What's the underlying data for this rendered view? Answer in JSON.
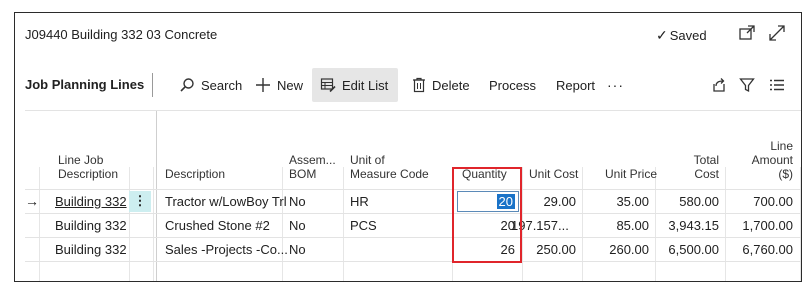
{
  "header": {
    "title": "J09440 Building 332 03 Concrete",
    "saved_label": "Saved",
    "check_glyph": "✓"
  },
  "toolbar": {
    "section_title": "Job Planning Lines",
    "search_label": "Search",
    "new_label": "New",
    "edit_list_label": "Edit List",
    "delete_label": "Delete",
    "process_label": "Process",
    "report_label": "Report",
    "more_glyph": "···"
  },
  "columns": {
    "line_job_description": [
      "Line Job",
      "Description"
    ],
    "description": "Description",
    "assembly_bom": [
      "Assem...",
      "BOM"
    ],
    "unit_of_measure": [
      "Unit of",
      "Measure Code"
    ],
    "quantity": "Quantity",
    "unit_cost": "Unit Cost",
    "unit_price": "Unit Price",
    "total_cost": [
      "Total",
      "Cost"
    ],
    "line_amount": [
      "Line",
      "Amount",
      "($)"
    ]
  },
  "rows": [
    {
      "job": "Building 332",
      "description": "Tractor w/LowBoy Trl",
      "bom": "No",
      "uom": "HR",
      "quantity": "20",
      "unit_cost": "29.00",
      "unit_price": "35.00",
      "total_cost": "580.00",
      "line_amount": "700.00"
    },
    {
      "job": "Building 332",
      "description": "Crushed Stone #2",
      "bom": "No",
      "uom": "PCS",
      "quantity": "20",
      "unit_cost": "197.157...",
      "unit_price": "85.00",
      "total_cost": "3,943.15",
      "line_amount": "1,700.00"
    },
    {
      "job": "Building 332",
      "description": "Sales -Projects -Co...",
      "bom": "No",
      "uom": "",
      "quantity": "26",
      "unit_cost": "250.00",
      "unit_price": "260.00",
      "total_cost": "6,500.00",
      "line_amount": "6,760.00"
    }
  ],
  "row_marker": "→",
  "row_menu_glyph": "⋮",
  "colors": {
    "highlight_box": "#e0252b",
    "selection": "#1a73c8",
    "row_menu_bg": "#cdeef0"
  },
  "icons": [
    "check-icon",
    "open-new-window-icon",
    "expand-icon",
    "search-icon",
    "plus-icon",
    "edit-list-icon",
    "trash-icon",
    "share-icon",
    "filter-icon",
    "list-view-icon"
  ]
}
